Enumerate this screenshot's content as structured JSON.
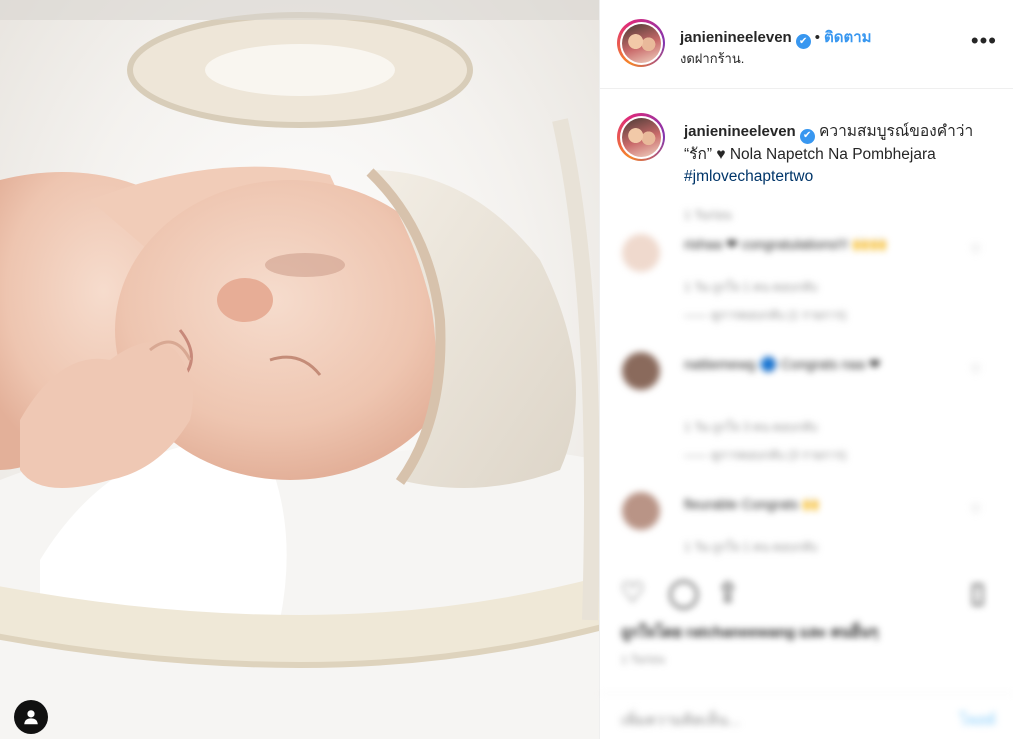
{
  "post": {
    "username": "janienineeleven",
    "verified_mark": "✔",
    "separator": "•",
    "follow_label": "ติดตาม",
    "location": "งดฝากร้าน.",
    "more_icon": "•••"
  },
  "caption": {
    "username": "janienineeleven",
    "text": "ความสมบูรณ์ของคำว่า “รัก” ♥ Nola Napetch Na Pombhejara",
    "hashtag": "#jmlovechaptertwo"
  },
  "comments_blurred": [
    {
      "text": "rishaa ❤ congratulations!!! 🙌🙌",
      "meta": "1 วัน    ถูกใจ 1 คน    ตอบกลับ",
      "replies": "—— ดูการตอบกลับ (1 รายการ)"
    },
    {
      "text": "nattiemewg 🔵 Congrats naa ❤",
      "meta": "1 วัน    ถูกใจ 3 คน    ตอบกลับ",
      "replies": "—— ดูการตอบกลับ (3 รายการ)"
    },
    {
      "text": "fleurable Congrats 🙌",
      "meta": "1 วัน    ถูกใจ 1 คน    ตอบกลับ",
      "replies": ""
    }
  ],
  "likes_text": "ถูกใจโดย ratchaneewang และ คนอื่นๆ",
  "time_ago": "1 วันก่อน",
  "add_comment": {
    "placeholder": "เพิ่มความคิดเห็น...",
    "post_label": "โพสต์"
  },
  "icons": {
    "user_tag": "user-icon",
    "like": "heart-icon",
    "comment": "comment-icon",
    "share": "share-icon",
    "save": "bookmark-icon"
  },
  "colors": {
    "link": "#3897f0",
    "hashtag": "#003569",
    "avatar_ring": "#dd2a7b"
  }
}
